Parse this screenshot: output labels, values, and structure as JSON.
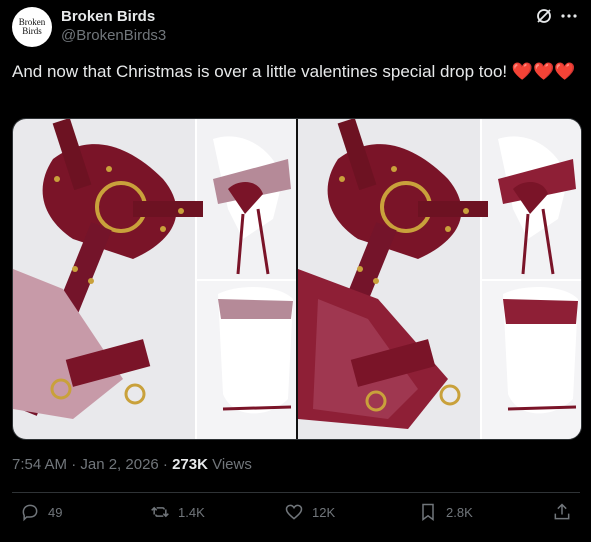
{
  "author": {
    "name": "Broken Birds",
    "handle": "@BrokenBirds3",
    "avatar_text_line1": "Broken",
    "avatar_text_line2": "Birds"
  },
  "tweet": {
    "text": "And now that Christmas is over a little valentines special drop too! ",
    "emoji": "❤️❤️❤️"
  },
  "meta": {
    "time": "7:54 AM · Jan 2, 2026 · ",
    "views_count": "273K",
    "views_label": " Views"
  },
  "actions": {
    "replies": "49",
    "reposts": "1.4K",
    "likes": "12K",
    "bookmarks": "2.8K"
  },
  "colors": {
    "background": "#000000",
    "text": "#e7e9ea",
    "muted": "#71767b",
    "divider": "#2f3336",
    "burgundy": "#7a1428",
    "gold": "#c9a13b"
  },
  "icons": [
    "grok-icon",
    "more-icon",
    "reply-icon",
    "repost-icon",
    "like-icon",
    "bookmark-icon",
    "share-icon"
  ]
}
